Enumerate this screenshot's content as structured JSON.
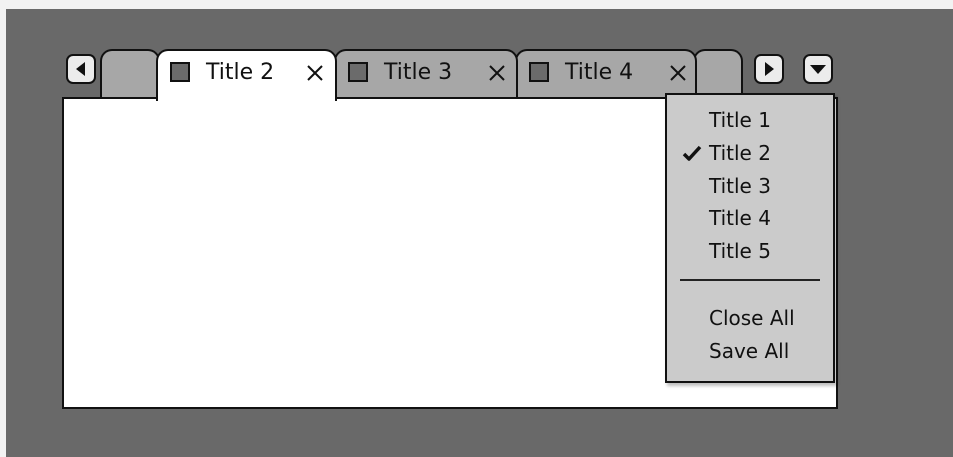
{
  "tabs": [
    {
      "label": "",
      "icon": "",
      "state": "overflow-left"
    },
    {
      "label": "Title 2",
      "icon": "tab-square-icon",
      "close": "close-icon",
      "state": "active"
    },
    {
      "label": "Title 3",
      "icon": "tab-square-icon",
      "close": "close-icon",
      "state": "inactive"
    },
    {
      "label": "Title 4",
      "icon": "tab-square-icon",
      "close": "close-icon",
      "state": "inactive"
    },
    {
      "label": "",
      "icon": "",
      "state": "overflow-right"
    }
  ],
  "nav": {
    "left_icon": "triangle-left-icon",
    "right_icon": "triangle-right-icon",
    "menu_icon": "triangle-down-icon"
  },
  "menu": {
    "items": [
      {
        "label": "Title 1",
        "checked": false
      },
      {
        "label": "Title 2",
        "checked": true
      },
      {
        "label": "Title 3",
        "checked": false
      },
      {
        "label": "Title 4",
        "checked": false
      },
      {
        "label": "Title 5",
        "checked": false
      }
    ],
    "actions": [
      {
        "label": "Close All"
      },
      {
        "label": "Save All"
      }
    ],
    "check_icon": "checkmark-icon"
  },
  "colors": {
    "backdrop": "#696969",
    "tab_inactive": "#a7a7a7",
    "tab_active": "#ffffff",
    "menu_bg": "#cbcbcb",
    "tab_icon_fill": "#6b6b6b"
  }
}
